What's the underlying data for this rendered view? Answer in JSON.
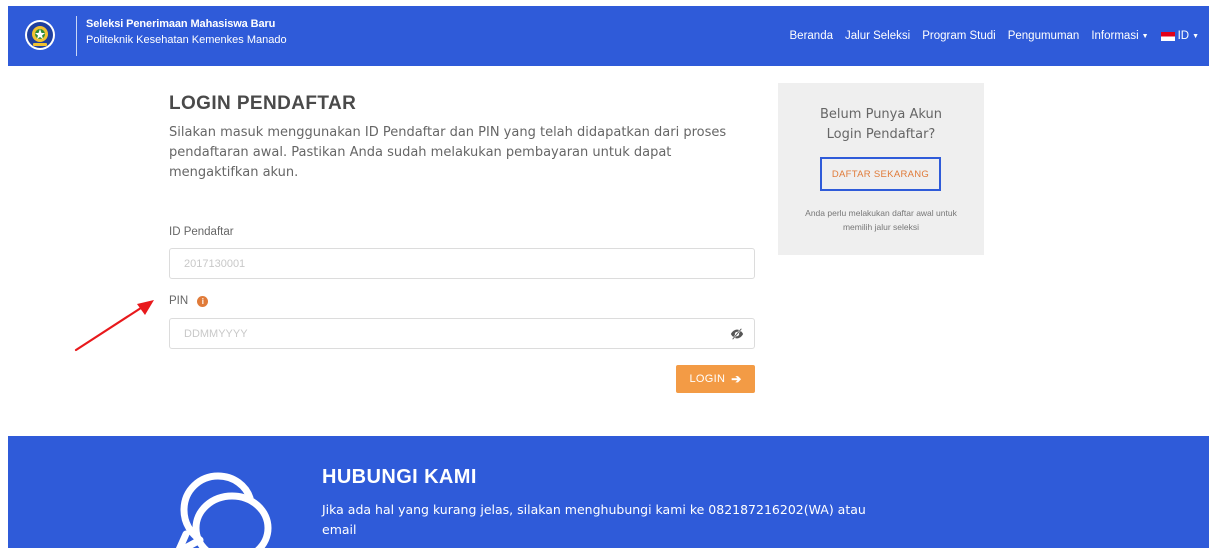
{
  "header": {
    "title": "Seleksi Penerimaan Mahasiswa Baru",
    "subtitle": "Politeknik Kesehatan Kemenkes Manado",
    "nav": {
      "beranda": "Beranda",
      "jalur_seleksi": "Jalur Seleksi",
      "program_studi": "Program Studi",
      "pengumuman": "Pengumuman",
      "informasi": "Informasi",
      "language": "ID"
    }
  },
  "login": {
    "title": "LOGIN PENDAFTAR",
    "description": "Silakan masuk menggunakan ID Pendaftar dan PIN yang telah didapatkan dari proses pendaftaran awal. Pastikan Anda sudah melakukan pembayaran untuk dapat mengaktifkan akun.",
    "id_label": "ID Pendaftar",
    "id_placeholder": "2017130001",
    "pin_label": "PIN",
    "pin_placeholder": "DDMMYYYY",
    "button_label": "LOGIN"
  },
  "side_card": {
    "title": "Belum Punya Akun Login Pendaftar?",
    "button_label": "DAFTAR SEKARANG",
    "note": "Anda perlu melakukan daftar awal untuk memilih jalur seleksi"
  },
  "footer": {
    "title": "HUBUNGI KAMI",
    "text": "Jika ada hal yang kurang jelas, silakan menghubungi kami ke 082187216202(WA) atau email"
  },
  "colors": {
    "primary": "#2f5bd9",
    "accent_orange": "#f39b45",
    "info_orange": "#e07b39",
    "card_bg": "#efefef",
    "annotation_red": "#e8191c"
  },
  "icons": {
    "logo": "institution-emblem",
    "info": "info-circle-icon",
    "eye": "eye-slash-icon",
    "login_arrow": "arrow-right-icon",
    "contact": "chat-bubbles-icon"
  }
}
